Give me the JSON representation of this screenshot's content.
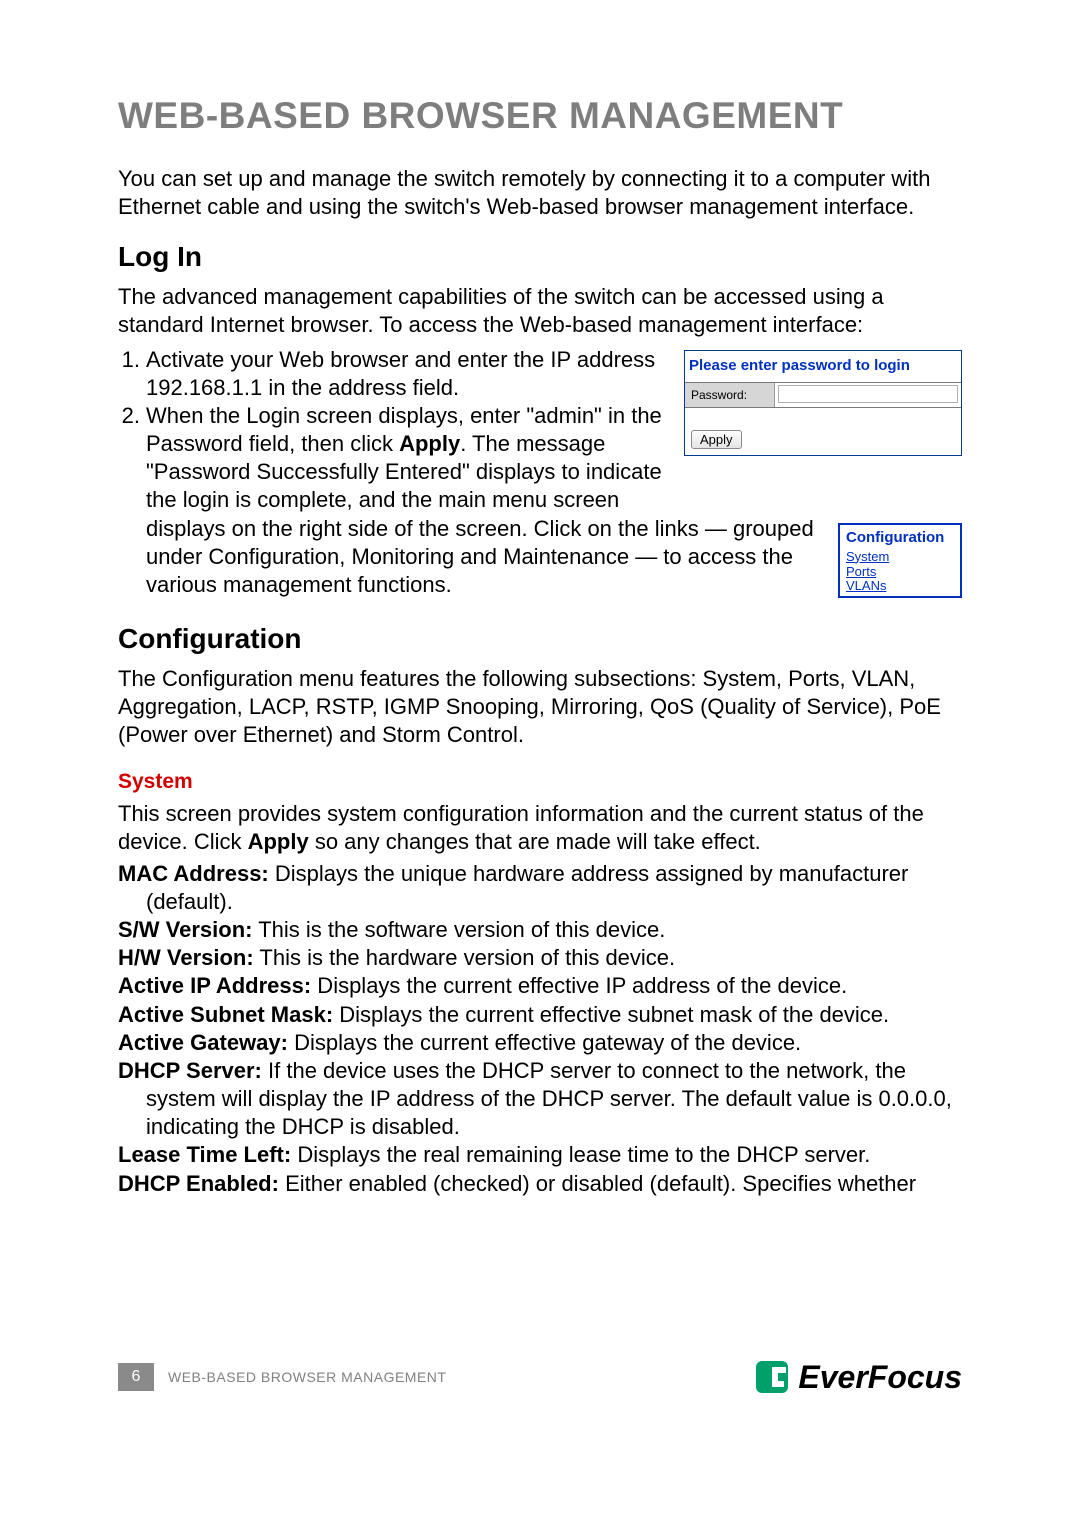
{
  "title": "WEB-BASED BROWSER MANAGEMENT",
  "intro": "You can set up and manage the switch remotely by connecting it to a computer with Ethernet cable and using the switch's Web-based browser management interface.",
  "login": {
    "heading": "Log In",
    "intro": "The advanced management capabilities of the switch can be accessed using a standard Internet browser. To access the Web-based management interface:",
    "steps": {
      "n1": "1.",
      "s1": "Activate your Web browser and enter the IP address 192.168.1.1 in the address field.",
      "n2": "2.",
      "s2a": "When the Login screen displays, enter \"admin\" in the Password field, then click ",
      "s2b": "Apply",
      "s2c": ". The message \"Password Successfully Entered\" displays to indicate the login is complete, and the main menu screen",
      "s2d": "displays on the right side of the screen. Click on the links — grouped under Configuration, Monitoring and Maintenance — to access the various management functions."
    },
    "box": {
      "header": "Please enter password to login",
      "label": "Password:",
      "button": "Apply"
    },
    "menu": {
      "head": "Configuration",
      "i1": "System",
      "i2": "Ports",
      "i3": "VLANs"
    }
  },
  "config": {
    "heading": "Configuration",
    "intro": "The Configuration menu features the following subsections: System, Ports, VLAN, Aggregation, LACP, RSTP, IGMP Snooping, Mirroring, QoS (Quality of Service), PoE (Power over Ethernet) and Storm Control.",
    "system_h": "System",
    "system_p1a": "This screen provides system configuration information and the current status of the device. Click ",
    "system_p1b": "Apply",
    "system_p1c": " so any changes that are made will take effect.",
    "mac_l": "MAC Address:",
    "mac_t": " Displays the unique hardware address assigned by manufacturer",
    "mac_t2": "(default).",
    "sw_l": "S/W Version:",
    "sw_t": " This is the software version of this device.",
    "hw_l": "H/W Version:",
    "hw_t": " This is the hardware version of this device.",
    "ip_l": "Active IP Address:",
    "ip_t": " Displays the current effective IP address of the device.",
    "sm_l": "Active Subnet Mask:",
    "sm_t": " Displays the current effective subnet mask of the device.",
    "gw_l": "Active Gateway:",
    "gw_t": " Displays the current effective gateway of the device.",
    "ds_l": "DHCP Server:",
    "ds_t": " If the device uses the DHCP server to connect to the network, the",
    "ds_t2": "system will display the IP address of the DHCP server. The default value is 0.0.0.0, indicating the DHCP is disabled.",
    "lt_l": "Lease Time Left:",
    "lt_t": " Displays the real remaining lease time to the DHCP server.",
    "de_l": "DHCP Enabled:",
    "de_t": " Either enabled (checked) or disabled (default). Specifies whether"
  },
  "footer": {
    "page": "6",
    "title": "WEB-BASED BROWSER MANAGEMENT",
    "brand": "EverFocus"
  }
}
